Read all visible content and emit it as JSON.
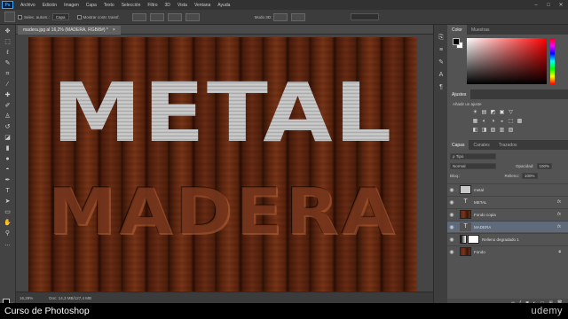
{
  "menubar": {
    "logo": "Ps",
    "items": [
      "Archivo",
      "Edición",
      "Imagen",
      "Capa",
      "Texto",
      "Selección",
      "Filtro",
      "3D",
      "Vista",
      "Ventana",
      "Ayuda"
    ]
  },
  "options": {
    "field1": "Capa",
    "check1": "Selec. autom.:",
    "check2": "Mostrar contr. transf.",
    "mode3d": "Modo 3D:"
  },
  "document": {
    "tab": "madera.jpg al 16,2% (MADERA, RGB/8#) *",
    "close": "×",
    "metal_text": "METAL",
    "madera_text": "MADERA"
  },
  "status": {
    "zoom": "16,29%",
    "doc_size": "Doc: 14,3 MB/127,4 MB"
  },
  "color_panel": {
    "tabs": [
      "Color",
      "Muestras"
    ]
  },
  "adjust_panel": {
    "title": "Ajustes",
    "add_label": "Añadir un ajuste",
    "row1": [
      "☀",
      "▤",
      "◩",
      "▣",
      "▽"
    ],
    "row2": [
      "▦",
      "◐",
      "◑",
      "◒",
      "⬚",
      "▩"
    ],
    "row3": [
      "◧",
      "◨",
      "▨",
      "▥",
      "▧"
    ]
  },
  "layers_panel": {
    "tabs": [
      "Capas",
      "Canales",
      "Trazados"
    ],
    "kind": "ρ Tipo",
    "blend": "Normal",
    "opacity_label": "Opacidad:",
    "opacity": "100%",
    "lock_label": "Bloq.:",
    "fill_label": "Relleno:",
    "fill": "100%",
    "layers": [
      {
        "name": "metal",
        "thumb": "smart",
        "fx": ""
      },
      {
        "name": "METAL",
        "thumb": "text",
        "fx": "fx"
      },
      {
        "name": "Fondo copia",
        "thumb": "wood",
        "fx": "fx"
      },
      {
        "name": "MADERA",
        "thumb": "text",
        "fx": "fx",
        "selected": true
      },
      {
        "name": "Relleno degradado 1",
        "thumb": "grad",
        "fx": ""
      },
      {
        "name": "Fondo",
        "thumb": "wood",
        "fx": ""
      }
    ]
  },
  "caption": {
    "title": "Curso de Photoshop",
    "brand": "udemy"
  }
}
